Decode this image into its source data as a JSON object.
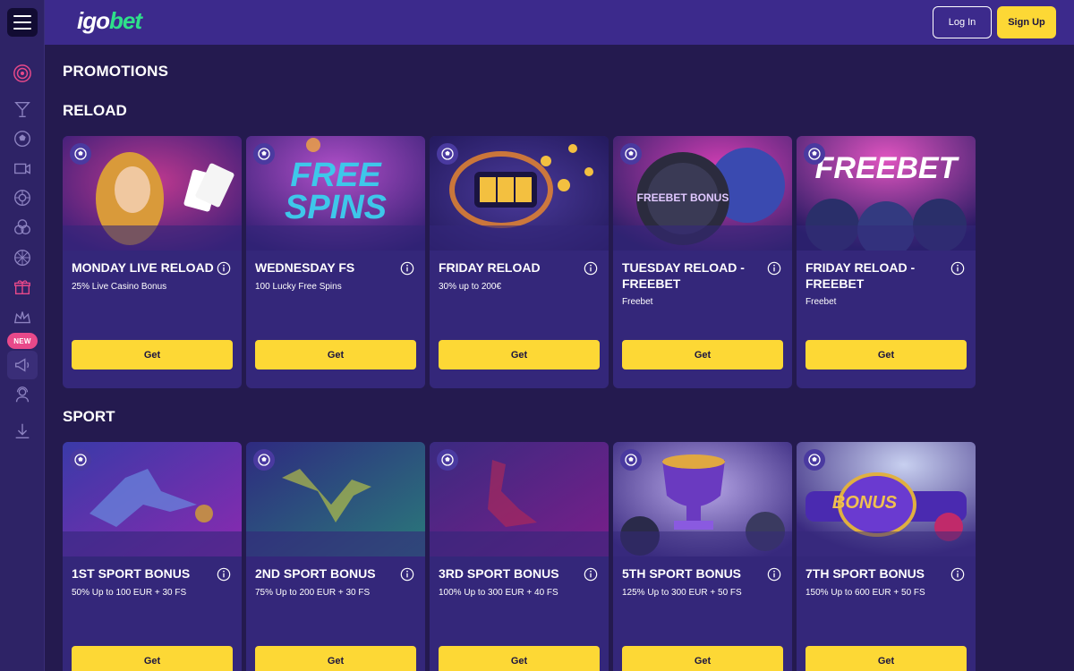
{
  "header": {
    "logo_part1": "igo",
    "logo_part2": "bet",
    "login_label": "Log In",
    "signup_label": "Sign Up"
  },
  "sidebar": {
    "new_badge": "NEW"
  },
  "page_title": "PROMOTIONS",
  "sections": [
    {
      "title": "RELOAD",
      "cards": [
        {
          "title": "MONDAY LIVE RELOAD",
          "subtitle": "25% Live Casino Bonus",
          "button": "Get"
        },
        {
          "title": "WEDNESDAY FS",
          "subtitle": "100 Lucky Free Spins",
          "button": "Get",
          "image_text": "FREE SPINS"
        },
        {
          "title": "FRIDAY RELOAD",
          "subtitle": "30% up to 200€",
          "button": "Get"
        },
        {
          "title": "TUESDAY RELOAD - FREEBET",
          "subtitle": "Freebet",
          "button": "Get",
          "image_text": "FREEBET BONUS"
        },
        {
          "title": "FRIDAY RELOAD - FREEBET",
          "subtitle": "Freebet",
          "button": "Get",
          "image_text": "FREEBET"
        }
      ]
    },
    {
      "title": "SPORT",
      "cards": [
        {
          "title": "1ST SPORT BONUS",
          "subtitle": "50% Up to 100 EUR + 30 FS",
          "button": "Get"
        },
        {
          "title": "2ND SPORT BONUS",
          "subtitle": "75% Up to 200 EUR + 30 FS",
          "button": "Get"
        },
        {
          "title": "3RD SPORT BONUS",
          "subtitle": "100% Up to 300 EUR + 40 FS",
          "button": "Get"
        },
        {
          "title": "5TH SPORT BONUS",
          "subtitle": "125% Up to 300 EUR + 50 FS",
          "button": "Get"
        },
        {
          "title": "7TH SPORT BONUS",
          "subtitle": "150% Up to 600 EUR + 50 FS",
          "button": "Get",
          "image_text": "BONUS"
        }
      ]
    }
  ],
  "colors": {
    "background": "#241a4f",
    "header": "#3c2a8c",
    "card": "#34277a",
    "accent_yellow": "#fdd835",
    "logo_green": "#2ee08a",
    "badge_pink": "#e8498a"
  }
}
